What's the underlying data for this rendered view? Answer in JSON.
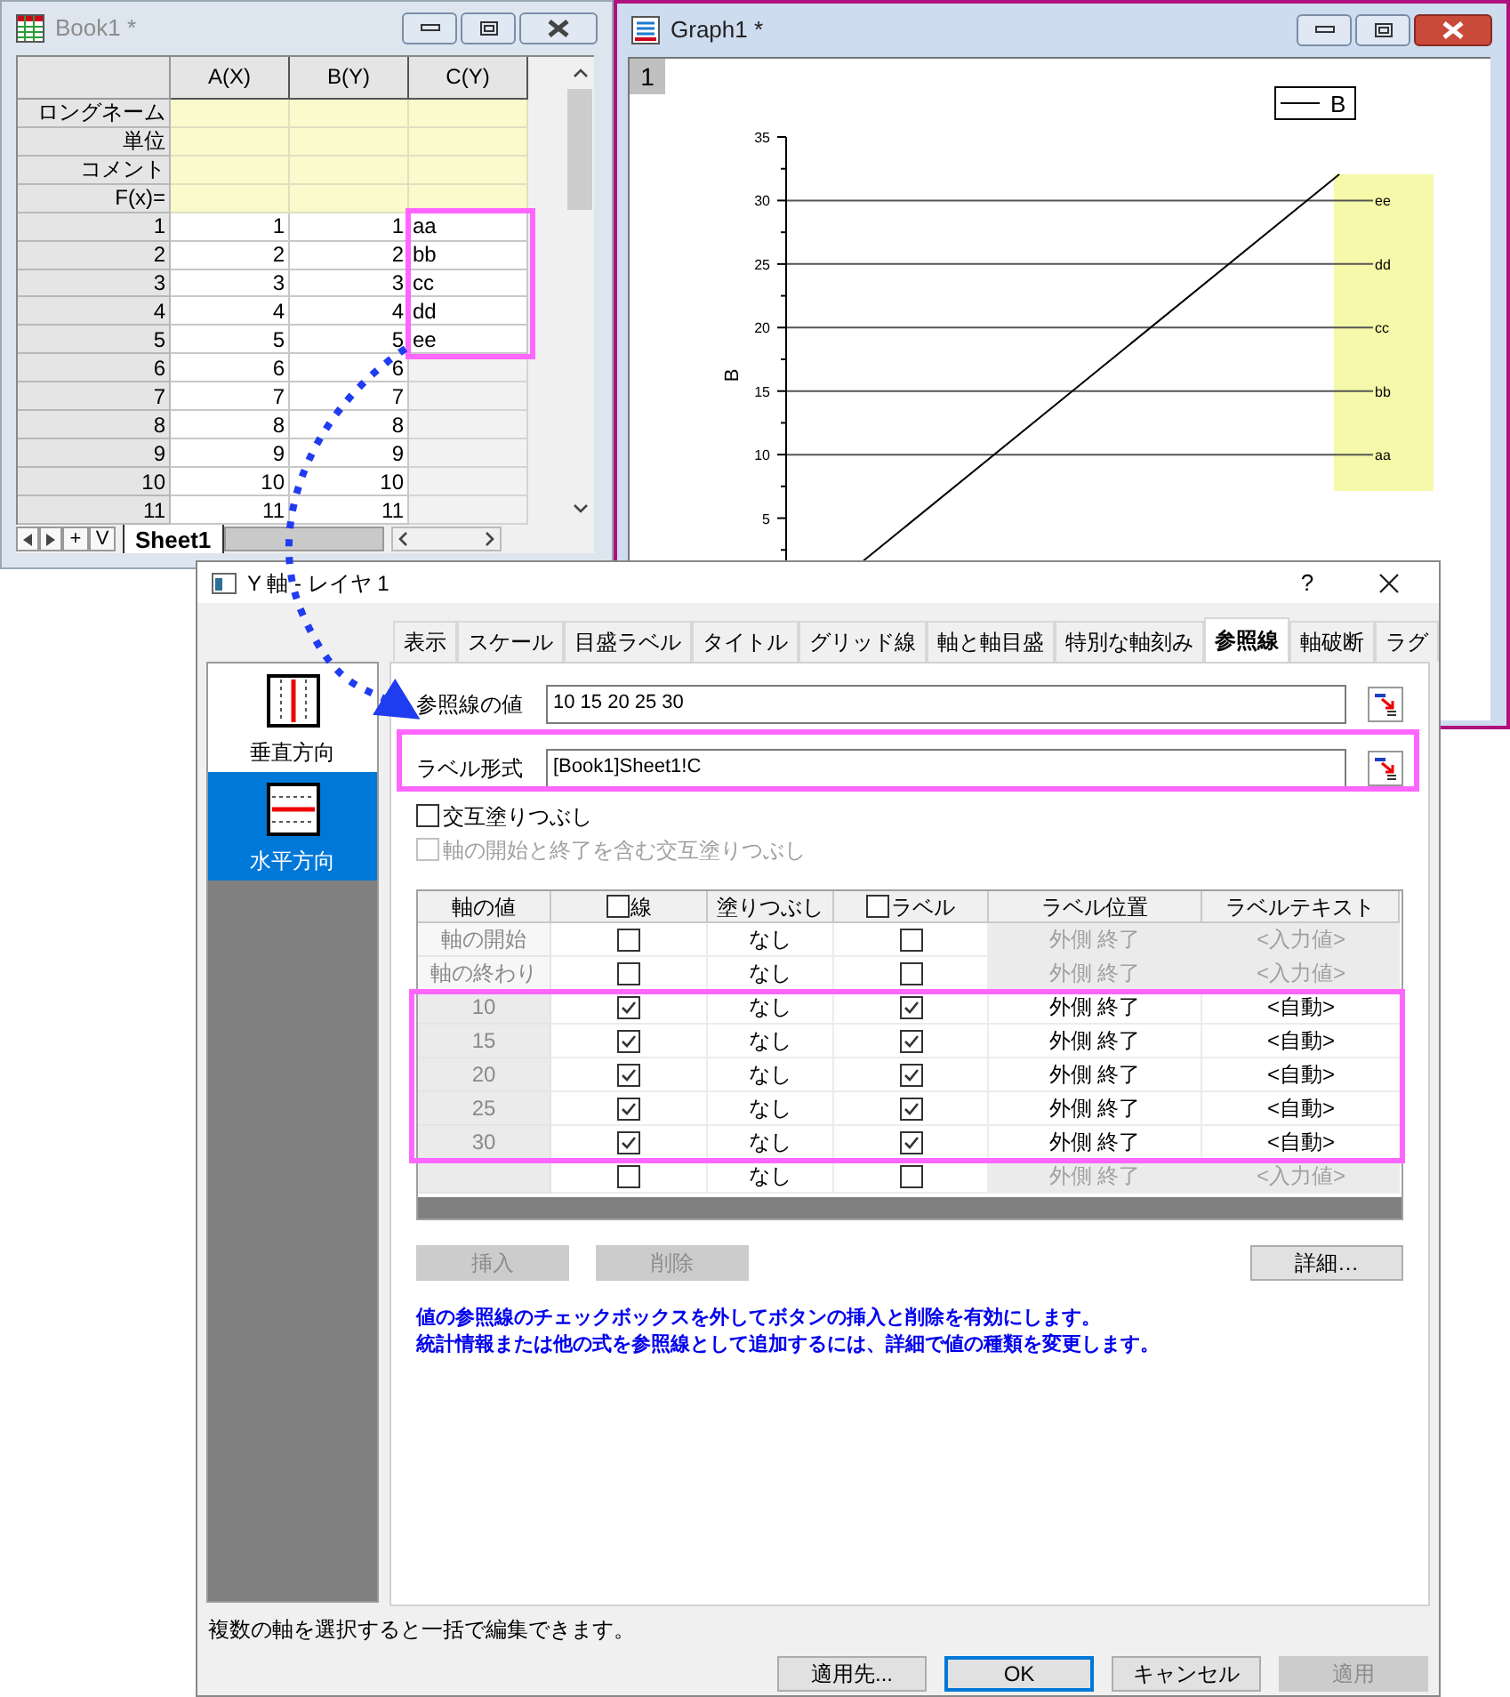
{
  "book": {
    "title": "Book1 *",
    "columns": [
      "A(X)",
      "B(Y)",
      "C(Y)"
    ],
    "meta_rows": [
      "ロングネーム",
      "単位",
      "コメント",
      "F(x)="
    ],
    "rows": [
      {
        "label": "1",
        "cells": [
          "1",
          "1",
          "aa"
        ]
      },
      {
        "label": "2",
        "cells": [
          "2",
          "2",
          "bb"
        ]
      },
      {
        "label": "3",
        "cells": [
          "3",
          "3",
          "cc"
        ]
      },
      {
        "label": "4",
        "cells": [
          "4",
          "4",
          "dd"
        ]
      },
      {
        "label": "5",
        "cells": [
          "5",
          "5",
          "ee"
        ]
      },
      {
        "label": "6",
        "cells": [
          "6",
          "6"
        ]
      },
      {
        "label": "7",
        "cells": [
          "7",
          "7"
        ]
      },
      {
        "label": "8",
        "cells": [
          "8",
          "8"
        ]
      },
      {
        "label": "9",
        "cells": [
          "9",
          "9"
        ]
      },
      {
        "label": "10",
        "cells": [
          "10",
          "10"
        ]
      },
      {
        "label": "11",
        "cells": [
          "11",
          "11"
        ]
      }
    ],
    "sheet_buttons": [
      "+",
      "V"
    ],
    "sheets": [
      {
        "label": "Sheet1",
        "selected": true
      }
    ]
  },
  "graph": {
    "title": "Graph1 *",
    "layer": "1",
    "legend": "B",
    "axis_title": "B",
    "y_ticks": [
      "35",
      "30",
      "25",
      "20",
      "15",
      "10",
      "5"
    ],
    "reference_labels": [
      "ee",
      "dd",
      "cc",
      "bb",
      "aa"
    ]
  },
  "dialog": {
    "title": "Y 軸 - レイヤ 1",
    "help": "?",
    "tabs": [
      {
        "label": "表示",
        "selected": false
      },
      {
        "label": "スケール",
        "selected": false
      },
      {
        "label": "目盛ラベル",
        "selected": false
      },
      {
        "label": "タイトル",
        "selected": false
      },
      {
        "label": "グリッド線",
        "selected": false
      },
      {
        "label": "軸と軸目盛",
        "selected": false
      },
      {
        "label": "特別な軸刻み",
        "selected": false
      },
      {
        "label": "参照線",
        "selected": true
      },
      {
        "label": "軸破断",
        "selected": false
      },
      {
        "label": "ラグ",
        "selected": false
      }
    ],
    "sides": [
      {
        "label": "垂直方向",
        "selected": false
      },
      {
        "label": "水平方向",
        "selected": true
      }
    ],
    "fields": [
      {
        "label": "参照線の値",
        "value": "10 15 20 25 30"
      },
      {
        "label": "ラベル形式",
        "value": "[Book1]Sheet1!C"
      }
    ],
    "options": [
      {
        "label": "交互塗りつぶし",
        "checked": false,
        "disabled": false
      },
      {
        "label": "軸の開始と終了を含む交互塗りつぶし",
        "checked": false,
        "disabled": true
      }
    ],
    "table": {
      "columns": [
        {
          "label": "軸の値",
          "kind": "text"
        },
        {
          "label": "線",
          "kind": "check",
          "checked": false
        },
        {
          "label": "塗りつぶし",
          "kind": "text"
        },
        {
          "label": "ラベル",
          "kind": "check",
          "checked": false
        },
        {
          "label": "ラベル位置",
          "kind": "text"
        },
        {
          "label": "ラベルテキスト",
          "kind": "text"
        }
      ],
      "rows": [
        {
          "kind": "axis",
          "value": "軸の開始",
          "line": false,
          "fill": "なし",
          "label": false,
          "position": "外側 終了",
          "text": "<入力値>",
          "enabled": false
        },
        {
          "kind": "axis",
          "value": "軸の終わり",
          "line": false,
          "fill": "なし",
          "label": false,
          "position": "外側 終了",
          "text": "<入力値>",
          "enabled": false
        },
        {
          "kind": "value",
          "value": "10",
          "line": true,
          "fill": "なし",
          "label": true,
          "position": "外側 終了",
          "text": "<自動>",
          "enabled": true
        },
        {
          "kind": "value",
          "value": "15",
          "line": true,
          "fill": "なし",
          "label": true,
          "position": "外側 終了",
          "text": "<自動>",
          "enabled": true
        },
        {
          "kind": "value",
          "value": "20",
          "line": true,
          "fill": "なし",
          "label": true,
          "position": "外側 終了",
          "text": "<自動>",
          "enabled": true
        },
        {
          "kind": "value",
          "value": "25",
          "line": true,
          "fill": "なし",
          "label": true,
          "position": "外側 終了",
          "text": "<自動>",
          "enabled": true
        },
        {
          "kind": "value",
          "value": "30",
          "line": true,
          "fill": "なし",
          "label": true,
          "position": "外側 終了",
          "text": "<自動>",
          "enabled": true
        },
        {
          "kind": "new",
          "line": false,
          "fill": "なし",
          "label": false,
          "position": "外側 終了",
          "text": "<入力値>",
          "enabled": false
        }
      ]
    },
    "row_buttons": [
      {
        "label": "挿入",
        "disabled": true
      },
      {
        "label": "削除",
        "disabled": true
      },
      {
        "label": "詳細…",
        "disabled": false
      }
    ],
    "hint": [
      "値の参照線のチェックボックスを外してボタンの挿入と削除を有効にします。",
      "統計情報または他の式を参照線として追加するには、詳細で値の種類を変更します。"
    ],
    "status": "複数の軸を選択すると一括で編集できます。",
    "buttons": [
      {
        "label": "適用先...",
        "disabled": false,
        "default": false
      },
      {
        "label": "OK",
        "disabled": false,
        "default": true
      },
      {
        "label": "キャンセル",
        "disabled": false,
        "default": false
      },
      {
        "label": "適用",
        "disabled": true,
        "default": false
      }
    ]
  }
}
